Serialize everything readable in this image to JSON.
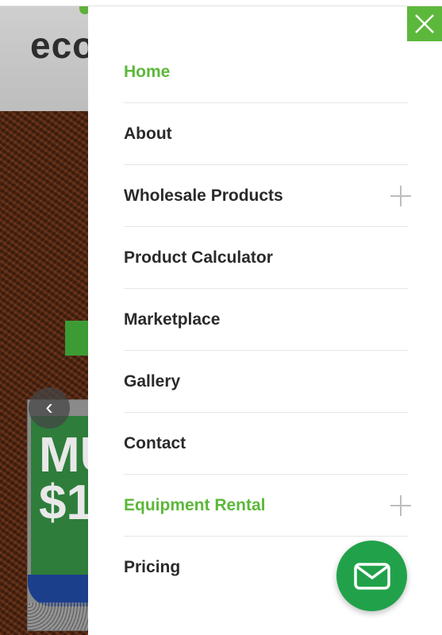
{
  "background": {
    "logo_text": "eco",
    "card_text": "MU\n$1",
    "prev_glyph": "‹"
  },
  "drawer": {
    "close_icon": "close-icon",
    "items": [
      {
        "label": "Home",
        "active": true,
        "expandable": false
      },
      {
        "label": "About",
        "active": false,
        "expandable": false
      },
      {
        "label": "Wholesale Products",
        "active": false,
        "expandable": true
      },
      {
        "label": "Product Calculator",
        "active": false,
        "expandable": false
      },
      {
        "label": "Marketplace",
        "active": false,
        "expandable": false
      },
      {
        "label": "Gallery",
        "active": false,
        "expandable": false
      },
      {
        "label": "Contact",
        "active": false,
        "expandable": false
      },
      {
        "label": "Equipment Rental",
        "active": true,
        "expandable": true
      },
      {
        "label": "Pricing",
        "active": false,
        "expandable": false
      }
    ]
  },
  "fab": {
    "icon": "mail-icon"
  },
  "colors": {
    "accent": "#5cb83a",
    "fab": "#21a24a",
    "text": "#2a2a2a"
  }
}
